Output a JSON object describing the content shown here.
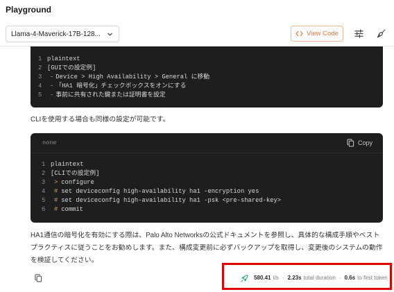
{
  "header": {
    "title": "Playground"
  },
  "toolbar": {
    "model_select": {
      "value": "Llama-4-Maverick-17B-128...",
      "icon": "chevron-down-icon"
    },
    "view_code": {
      "label": "View Code",
      "icon": "code-icon"
    },
    "parameters_icon": "sliders-icon",
    "clear_icon": "broom-icon",
    "accent_color": "#e8743b"
  },
  "message": {
    "code_block_1": {
      "lines": [
        {
          "n": "1",
          "marker": "",
          "text": "plaintext"
        },
        {
          "n": "2",
          "marker": "",
          "text": "[GUIでの設定例]"
        },
        {
          "n": "3",
          "marker": "-",
          "text": "Device > High Availability > General に移動"
        },
        {
          "n": "4",
          "marker": "-",
          "text": "「HA1 暗号化」チェックボックスをオンにする"
        },
        {
          "n": "5",
          "marker": "-",
          "text": "事前に共有された鍵または証明書を設定"
        }
      ]
    },
    "paragraph_1": "CLIを使用する場合も同様の設定が可能です。",
    "code_block_2": {
      "language": "none",
      "copy_label": "Copy",
      "copy_icon": "copy-icon",
      "lines": [
        {
          "n": "1",
          "marker": "",
          "text": "plaintext"
        },
        {
          "n": "2",
          "marker": "",
          "text": "[CLIでの設定例]"
        },
        {
          "n": "3",
          "marker": ">",
          "text": "configure"
        },
        {
          "n": "4",
          "marker": "#",
          "text": "set deviceconfig high-availability ha1 -encryption yes"
        },
        {
          "n": "5",
          "marker": "#",
          "text": "set deviceconfig high-availability ha1 -psk <pre-shared-key>"
        },
        {
          "n": "6",
          "marker": "#",
          "text": "commit"
        }
      ]
    },
    "paragraph_2": "HA1通信の暗号化を有効にする際は、Palo Alto Networksの公式ドキュメントを参照し、具体的な構成手順やベストプラクティスに従うことをお勧めします。また、構成変更前に必ずバックアップを取得し、変更後のシステムの動作を検証してください。",
    "copy_message_icon": "copy-icon"
  },
  "stats": {
    "icon": "rocket-icon",
    "icon_color": "#1f9e7a",
    "throughput_value": "580.41",
    "throughput_unit": "t/s",
    "separator": "·",
    "duration_value": "2.23s",
    "duration_label": "total duration",
    "ttft_value": "0.6s",
    "ttft_label": "to first token"
  },
  "highlight_color": "#e00000"
}
